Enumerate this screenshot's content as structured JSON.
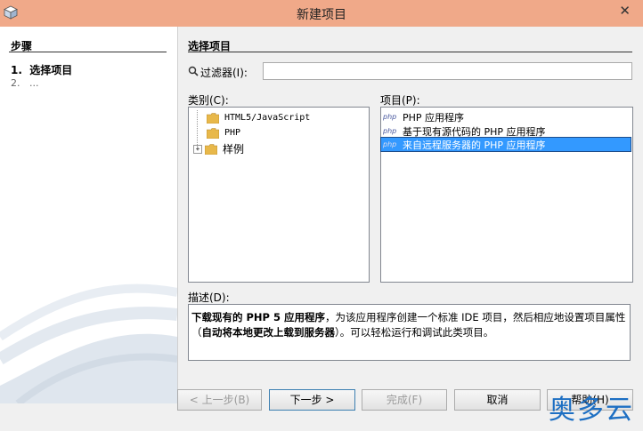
{
  "window": {
    "title": "新建项目",
    "close_glyph": "✕"
  },
  "steps": {
    "heading": "步骤",
    "items": [
      {
        "num": "1.",
        "label": "选择项目"
      },
      {
        "num": "2.",
        "label": "..."
      }
    ]
  },
  "main": {
    "section_title": "选择项目",
    "filter": {
      "label": "过滤器(I):",
      "value": "",
      "placeholder": ""
    },
    "categories": {
      "label": "类别(C):",
      "items": [
        {
          "label": "HTML5/JavaScript",
          "icon": "folder-icon"
        },
        {
          "label": "PHP",
          "icon": "folder-icon"
        },
        {
          "label": "样例",
          "icon": "folder-icon",
          "expander": "+"
        }
      ]
    },
    "projects": {
      "label": "项目(P):",
      "items": [
        {
          "label": "PHP 应用程序",
          "icon": "php-icon",
          "icon_text": "php"
        },
        {
          "label": "基于现有源代码的 PHP 应用程序",
          "icon": "php-icon",
          "icon_text": "php"
        },
        {
          "label": "来自远程服务器的 PHP 应用程序",
          "icon": "php-icon",
          "icon_text": "php",
          "selected": true
        }
      ]
    },
    "description": {
      "label": "描述(D):",
      "bold1": "下载现有的 PHP 5 应用程序",
      "text1": "，为该应用程序创建一个标准 IDE 项目，然后相应地设置项目属性（",
      "bold2": "自动将本地更改上载到服务器",
      "text2": "）。可以轻松运行和调试此类项目。"
    }
  },
  "buttons": {
    "back": "< 上一步(B)",
    "next": "下一步 >",
    "finish": "完成(F)",
    "cancel": "取消",
    "help": "帮助(H)"
  },
  "watermark": "奥多云",
  "colors": {
    "titlebar": "#f0a989",
    "selection": "#3399ff",
    "watermark": "#1d6fc3"
  }
}
